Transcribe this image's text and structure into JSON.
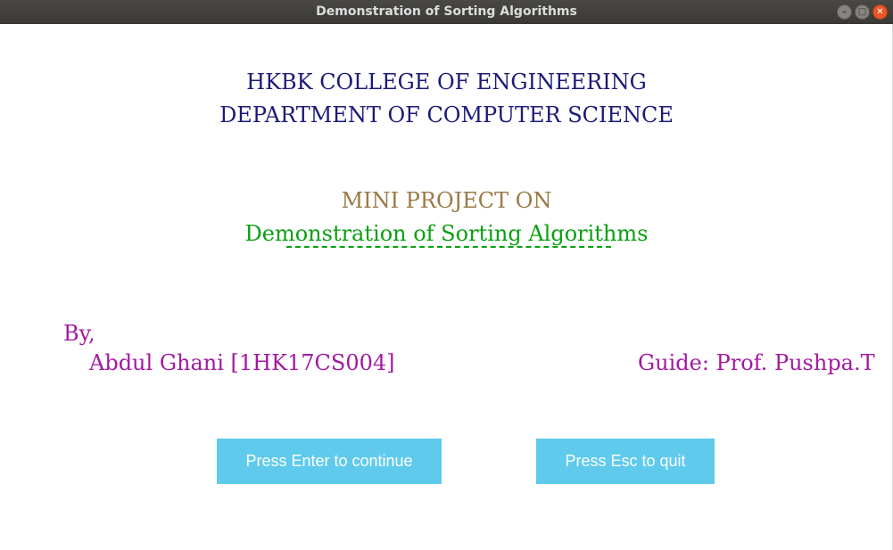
{
  "window": {
    "title": "Demonstration of Sorting Algorithms"
  },
  "header": {
    "college": "HKBK COLLEGE OF ENGINEERING",
    "department": "DEPARTMENT OF COMPUTER SCIENCE"
  },
  "project": {
    "intro": "MINI PROJECT ON",
    "title": "Demonstration of Sorting Algorithms"
  },
  "credits": {
    "by_label": "By,",
    "author": "Abdul Ghani [1HK17CS004]",
    "guide": "Guide: Prof. Pushpa.T"
  },
  "buttons": {
    "continue_label": "Press Enter to continue",
    "quit_label": "Press Esc to quit"
  },
  "colors": {
    "navy": "#1a1a7a",
    "tan": "#9a7a44",
    "green": "#0aa010",
    "purple": "#a319a3",
    "button": "#5fcaec"
  },
  "icons": {
    "minimize": "minimize-icon",
    "maximize": "maximize-icon",
    "close": "close-icon"
  }
}
